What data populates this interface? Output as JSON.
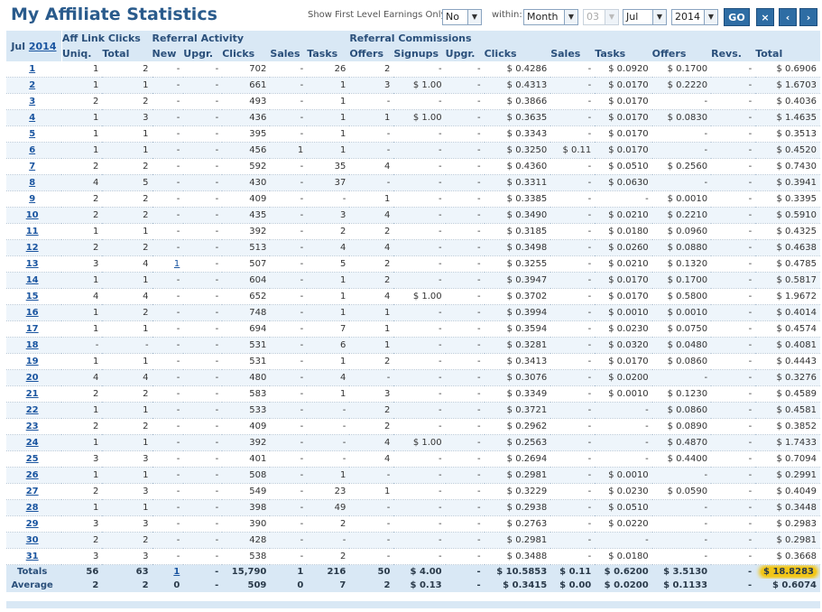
{
  "header": {
    "title": "My Affiliate Statistics",
    "first_level_label": "Show First Level Earnings Only:",
    "first_level_value": "No",
    "within_label": "within:",
    "period_value": "Month",
    "day_value": "03",
    "month_value": "Jul",
    "year_value": "2014",
    "go_label": "GO",
    "clear_glyph": "×",
    "prev_glyph": "‹",
    "next_glyph": "›"
  },
  "table": {
    "month_label": "Jul",
    "year_label": "2014",
    "groups": {
      "aff_link_clicks": "Aff Link Clicks",
      "referral_activity": "Referral Activity",
      "referral_commissions": "Referral Commissions"
    },
    "columns": [
      "Uniq.",
      "Total",
      "New",
      "Upgr.",
      "Clicks",
      "Sales",
      "Tasks",
      "Offers",
      "Signups",
      "Upgr.",
      "Clicks",
      "Sales",
      "Tasks",
      "Offers",
      "Revs.",
      "Total"
    ],
    "rows": [
      [
        "1",
        "1",
        "2",
        "-",
        "-",
        "702",
        "-",
        "26",
        "2",
        "-",
        "-",
        "$ 0.4286",
        "-",
        "$ 0.0920",
        "$ 0.1700",
        "-",
        "$ 0.6906"
      ],
      [
        "2",
        "1",
        "1",
        "-",
        "-",
        "661",
        "-",
        "1",
        "3",
        "$ 1.00",
        "-",
        "$ 0.4313",
        "-",
        "$ 0.0170",
        "$ 0.2220",
        "-",
        "$ 1.6703"
      ],
      [
        "3",
        "2",
        "2",
        "-",
        "-",
        "493",
        "-",
        "1",
        "-",
        "-",
        "-",
        "$ 0.3866",
        "-",
        "$ 0.0170",
        "-",
        "-",
        "$ 0.4036"
      ],
      [
        "4",
        "1",
        "3",
        "-",
        "-",
        "436",
        "-",
        "1",
        "1",
        "$ 1.00",
        "-",
        "$ 0.3635",
        "-",
        "$ 0.0170",
        "$ 0.0830",
        "-",
        "$ 1.4635"
      ],
      [
        "5",
        "1",
        "1",
        "-",
        "-",
        "395",
        "-",
        "1",
        "-",
        "-",
        "-",
        "$ 0.3343",
        "-",
        "$ 0.0170",
        "-",
        "-",
        "$ 0.3513"
      ],
      [
        "6",
        "1",
        "1",
        "-",
        "-",
        "456",
        "1",
        "1",
        "-",
        "-",
        "-",
        "$ 0.3250",
        "$ 0.11",
        "$ 0.0170",
        "-",
        "-",
        "$ 0.4520"
      ],
      [
        "7",
        "2",
        "2",
        "-",
        "-",
        "592",
        "-",
        "35",
        "4",
        "-",
        "-",
        "$ 0.4360",
        "-",
        "$ 0.0510",
        "$ 0.2560",
        "-",
        "$ 0.7430"
      ],
      [
        "8",
        "4",
        "5",
        "-",
        "-",
        "430",
        "-",
        "37",
        "-",
        "-",
        "-",
        "$ 0.3311",
        "-",
        "$ 0.0630",
        "-",
        "-",
        "$ 0.3941"
      ],
      [
        "9",
        "2",
        "2",
        "-",
        "-",
        "409",
        "-",
        "-",
        "1",
        "-",
        "-",
        "$ 0.3385",
        "-",
        "-",
        "$ 0.0010",
        "-",
        "$ 0.3395"
      ],
      [
        "10",
        "2",
        "2",
        "-",
        "-",
        "435",
        "-",
        "3",
        "4",
        "-",
        "-",
        "$ 0.3490",
        "-",
        "$ 0.0210",
        "$ 0.2210",
        "-",
        "$ 0.5910"
      ],
      [
        "11",
        "1",
        "1",
        "-",
        "-",
        "392",
        "-",
        "2",
        "2",
        "-",
        "-",
        "$ 0.3185",
        "-",
        "$ 0.0180",
        "$ 0.0960",
        "-",
        "$ 0.4325"
      ],
      [
        "12",
        "2",
        "2",
        "-",
        "-",
        "513",
        "-",
        "4",
        "4",
        "-",
        "-",
        "$ 0.3498",
        "-",
        "$ 0.0260",
        "$ 0.0880",
        "-",
        "$ 0.4638"
      ],
      [
        "13",
        "3",
        "4",
        "1",
        "-",
        "507",
        "-",
        "5",
        "2",
        "-",
        "-",
        "$ 0.3255",
        "-",
        "$ 0.0210",
        "$ 0.1320",
        "-",
        "$ 0.4785"
      ],
      [
        "14",
        "1",
        "1",
        "-",
        "-",
        "604",
        "-",
        "1",
        "2",
        "-",
        "-",
        "$ 0.3947",
        "-",
        "$ 0.0170",
        "$ 0.1700",
        "-",
        "$ 0.5817"
      ],
      [
        "15",
        "4",
        "4",
        "-",
        "-",
        "652",
        "-",
        "1",
        "4",
        "$ 1.00",
        "-",
        "$ 0.3702",
        "-",
        "$ 0.0170",
        "$ 0.5800",
        "-",
        "$ 1.9672"
      ],
      [
        "16",
        "1",
        "2",
        "-",
        "-",
        "748",
        "-",
        "1",
        "1",
        "-",
        "-",
        "$ 0.3994",
        "-",
        "$ 0.0010",
        "$ 0.0010",
        "-",
        "$ 0.4014"
      ],
      [
        "17",
        "1",
        "1",
        "-",
        "-",
        "694",
        "-",
        "7",
        "1",
        "-",
        "-",
        "$ 0.3594",
        "-",
        "$ 0.0230",
        "$ 0.0750",
        "-",
        "$ 0.4574"
      ],
      [
        "18",
        "-",
        "-",
        "-",
        "-",
        "531",
        "-",
        "6",
        "1",
        "-",
        "-",
        "$ 0.3281",
        "-",
        "$ 0.0320",
        "$ 0.0480",
        "-",
        "$ 0.4081"
      ],
      [
        "19",
        "1",
        "1",
        "-",
        "-",
        "531",
        "-",
        "1",
        "2",
        "-",
        "-",
        "$ 0.3413",
        "-",
        "$ 0.0170",
        "$ 0.0860",
        "-",
        "$ 0.4443"
      ],
      [
        "20",
        "4",
        "4",
        "-",
        "-",
        "480",
        "-",
        "4",
        "-",
        "-",
        "-",
        "$ 0.3076",
        "-",
        "$ 0.0200",
        "-",
        "-",
        "$ 0.3276"
      ],
      [
        "21",
        "2",
        "2",
        "-",
        "-",
        "583",
        "-",
        "1",
        "3",
        "-",
        "-",
        "$ 0.3349",
        "-",
        "$ 0.0010",
        "$ 0.1230",
        "-",
        "$ 0.4589"
      ],
      [
        "22",
        "1",
        "1",
        "-",
        "-",
        "533",
        "-",
        "-",
        "2",
        "-",
        "-",
        "$ 0.3721",
        "-",
        "-",
        "$ 0.0860",
        "-",
        "$ 0.4581"
      ],
      [
        "23",
        "2",
        "2",
        "-",
        "-",
        "409",
        "-",
        "-",
        "2",
        "-",
        "-",
        "$ 0.2962",
        "-",
        "-",
        "$ 0.0890",
        "-",
        "$ 0.3852"
      ],
      [
        "24",
        "1",
        "1",
        "-",
        "-",
        "392",
        "-",
        "-",
        "4",
        "$ 1.00",
        "-",
        "$ 0.2563",
        "-",
        "-",
        "$ 0.4870",
        "-",
        "$ 1.7433"
      ],
      [
        "25",
        "3",
        "3",
        "-",
        "-",
        "401",
        "-",
        "-",
        "4",
        "-",
        "-",
        "$ 0.2694",
        "-",
        "-",
        "$ 0.4400",
        "-",
        "$ 0.7094"
      ],
      [
        "26",
        "1",
        "1",
        "-",
        "-",
        "508",
        "-",
        "1",
        "-",
        "-",
        "-",
        "$ 0.2981",
        "-",
        "$ 0.0010",
        "-",
        "-",
        "$ 0.2991"
      ],
      [
        "27",
        "2",
        "3",
        "-",
        "-",
        "549",
        "-",
        "23",
        "1",
        "-",
        "-",
        "$ 0.3229",
        "-",
        "$ 0.0230",
        "$ 0.0590",
        "-",
        "$ 0.4049"
      ],
      [
        "28",
        "1",
        "1",
        "-",
        "-",
        "398",
        "-",
        "49",
        "-",
        "-",
        "-",
        "$ 0.2938",
        "-",
        "$ 0.0510",
        "-",
        "-",
        "$ 0.3448"
      ],
      [
        "29",
        "3",
        "3",
        "-",
        "-",
        "390",
        "-",
        "2",
        "-",
        "-",
        "-",
        "$ 0.2763",
        "-",
        "$ 0.0220",
        "-",
        "-",
        "$ 0.2983"
      ],
      [
        "30",
        "2",
        "2",
        "-",
        "-",
        "428",
        "-",
        "-",
        "-",
        "-",
        "-",
        "$ 0.2981",
        "-",
        "-",
        "-",
        "-",
        "$ 0.2981"
      ],
      [
        "31",
        "3",
        "3",
        "-",
        "-",
        "538",
        "-",
        "2",
        "-",
        "-",
        "-",
        "$ 0.3488",
        "-",
        "$ 0.0180",
        "-",
        "-",
        "$ 0.3668"
      ]
    ],
    "totals": [
      "Totals",
      "56",
      "63",
      "1",
      "-",
      "15,790",
      "1",
      "216",
      "50",
      "$ 4.00",
      "-",
      "$ 10.5853",
      "$ 0.11",
      "$ 0.6200",
      "$ 3.5130",
      "-",
      "$ 18.8283"
    ],
    "average": [
      "Average",
      "2",
      "2",
      "0",
      "-",
      "509",
      "0",
      "7",
      "2",
      "$ 0.13",
      "-",
      "$ 0.3415",
      "$ 0.00",
      "$ 0.0200",
      "$ 0.1133",
      "-",
      "$ 0.6074"
    ]
  },
  "colors": {
    "accent": "#2a5b8c",
    "header_bg": "#d9e8f5",
    "highlight": "#f2c618"
  }
}
